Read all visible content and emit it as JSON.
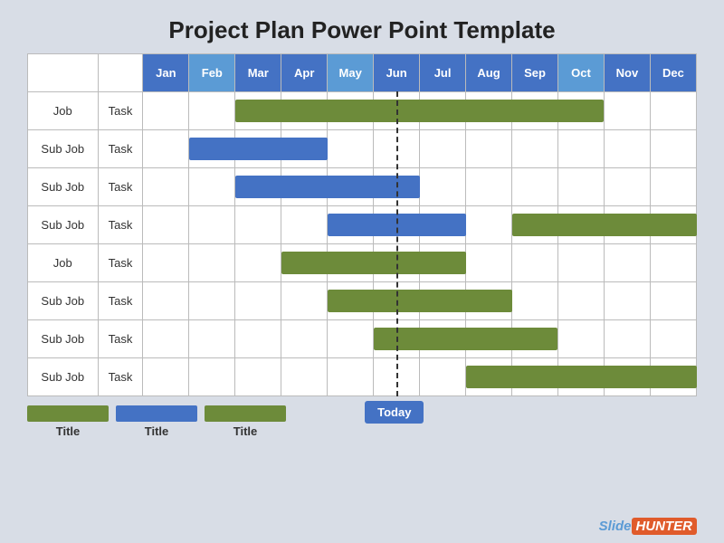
{
  "title": "Project Plan Power Point Template",
  "months": [
    "Jan",
    "Feb",
    "Mar",
    "Apr",
    "May",
    "Jun",
    "Jul",
    "Aug",
    "Sep",
    "Oct",
    "Nov",
    "Dec"
  ],
  "highlight_months": [
    "Feb",
    "May",
    "Oct"
  ],
  "rows": [
    {
      "job": "Job",
      "task": "Task",
      "bars": [
        {
          "start": 2,
          "span": 8,
          "type": "green"
        }
      ]
    },
    {
      "job": "Sub Job",
      "task": "Task",
      "bars": [
        {
          "start": 1,
          "span": 3,
          "type": "blue"
        }
      ]
    },
    {
      "job": "Sub Job",
      "task": "Task",
      "bars": [
        {
          "start": 2,
          "span": 4,
          "type": "blue"
        }
      ]
    },
    {
      "job": "Sub Job",
      "task": "Task",
      "bars": [
        {
          "start": 4,
          "span": 3,
          "type": "blue"
        },
        {
          "start": 8,
          "span": 4,
          "type": "green"
        }
      ]
    },
    {
      "job": "Job",
      "task": "Task",
      "bars": [
        {
          "start": 3,
          "span": 4,
          "type": "green"
        }
      ]
    },
    {
      "job": "Sub Job",
      "task": "Task",
      "bars": [
        {
          "start": 4,
          "span": 4,
          "type": "green"
        }
      ]
    },
    {
      "job": "Sub Job",
      "task": "Task",
      "bars": [
        {
          "start": 5,
          "span": 4,
          "type": "green"
        }
      ]
    },
    {
      "job": "Sub Job",
      "task": "Task",
      "bars": [
        {
          "start": 7,
          "span": 5,
          "type": "green"
        }
      ]
    }
  ],
  "today_col": 5,
  "legend": [
    {
      "color": "#6d8b3a",
      "label": "Title"
    },
    {
      "color": "#4472c4",
      "label": "Title"
    },
    {
      "color": "#6d8b3a",
      "label": "Title"
    }
  ],
  "logo": {
    "slide": "Slide",
    "hunter": "HUNTER"
  }
}
